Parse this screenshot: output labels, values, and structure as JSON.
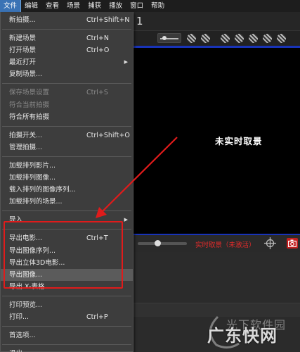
{
  "menubar": {
    "items": [
      "文件",
      "编辑",
      "查看",
      "场景",
      "捕获",
      "播放",
      "窗口",
      "帮助"
    ]
  },
  "toolbar": {
    "frame_number": "1"
  },
  "viewport": {
    "message": "未实时取景"
  },
  "controlbar": {
    "live_status": "实时取景（未激活）"
  },
  "file_menu": {
    "items": [
      {
        "label": "新拍摄...",
        "shortcut": "Ctrl+Shift+N"
      },
      {
        "label": "新建场景",
        "shortcut": "Ctrl+N"
      },
      {
        "label": "打开场景",
        "shortcut": "Ctrl+O"
      },
      {
        "label": "最近打开",
        "shortcut": ""
      },
      {
        "label": "复制场景...",
        "shortcut": ""
      },
      {
        "label": "保存场景设置",
        "shortcut": "Ctrl+S"
      },
      {
        "label": "符合当前拍摄",
        "shortcut": ""
      },
      {
        "label": "符合所有拍摄",
        "shortcut": ""
      },
      {
        "label": "拍摄开关...",
        "shortcut": "Ctrl+Shift+O"
      },
      {
        "label": "管理拍摄...",
        "shortcut": ""
      },
      {
        "label": "加载排列影片...",
        "shortcut": ""
      },
      {
        "label": "加载排列图像...",
        "shortcut": ""
      },
      {
        "label": "载入排列的图像序列...",
        "shortcut": ""
      },
      {
        "label": "加载排列的场景...",
        "shortcut": ""
      },
      {
        "label": "导入",
        "shortcut": ""
      },
      {
        "label": "导出电影...",
        "shortcut": "Ctrl+T"
      },
      {
        "label": "导出图像序列...",
        "shortcut": ""
      },
      {
        "label": "导出立体3D电影...",
        "shortcut": ""
      },
      {
        "label": "导出图像...",
        "shortcut": ""
      },
      {
        "label": "导出 X-表格...",
        "shortcut": ""
      },
      {
        "label": "打印预览...",
        "shortcut": ""
      },
      {
        "label": "打印...",
        "shortcut": "Ctrl+P"
      },
      {
        "label": "首选项...",
        "shortcut": ""
      },
      {
        "label": "退出",
        "shortcut": ""
      }
    ]
  },
  "watermark": {
    "line1": "光下软件园",
    "line2": "广东快网"
  }
}
